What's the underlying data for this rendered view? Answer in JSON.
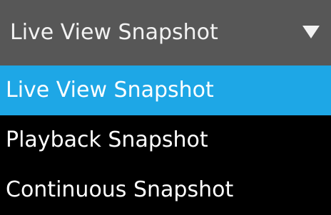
{
  "dropdown": {
    "selected_label": "Live View Snapshot",
    "arrow_icon": "triangle-down-icon",
    "options": [
      {
        "label": "Live View Snapshot",
        "highlighted": true
      },
      {
        "label": "Playback Snapshot",
        "highlighted": false
      },
      {
        "label": "Continuous Snapshot",
        "highlighted": false
      }
    ]
  },
  "colors": {
    "select_background": "#575757",
    "menu_background": "#000000",
    "highlight": "#1ea7e6",
    "text": "#ffffff"
  }
}
